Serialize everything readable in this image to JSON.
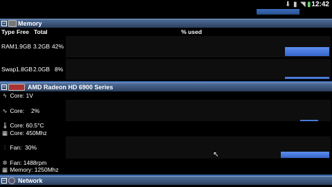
{
  "status": {
    "clock": "12:42"
  },
  "memory": {
    "title": "Memory",
    "headers": {
      "type": "Type",
      "free": "Free",
      "total": "Total",
      "used": "% used"
    },
    "rows": [
      {
        "type": "RAM",
        "free": "1.9GB",
        "total": "3.2GB",
        "pct": "42%",
        "level": 0.42
      },
      {
        "type": "Swap",
        "free": "1.8GB",
        "total": "2.0GB",
        "pct": "8%",
        "level": 0.08
      }
    ]
  },
  "gpu": {
    "title": "AMD Radeon HD 6900 Series",
    "core_voltage": "Core: 1V",
    "core_load_label": "Core:",
    "core_load": "2%",
    "core_temp": "Core: 60.5°C",
    "core_clock": "Core: 450Mhz",
    "fan_label": "Fan:",
    "fan_pct": "30%",
    "fan_rpm": "Fan: 1488rpm",
    "memory_clock": "Memory: 1250Mhz",
    "core_load_level": 0.02,
    "fan_level": 0.3
  },
  "network": {
    "title": "Network"
  },
  "colors": {
    "accent": "#3a6fd8",
    "header": "#3b5578"
  }
}
